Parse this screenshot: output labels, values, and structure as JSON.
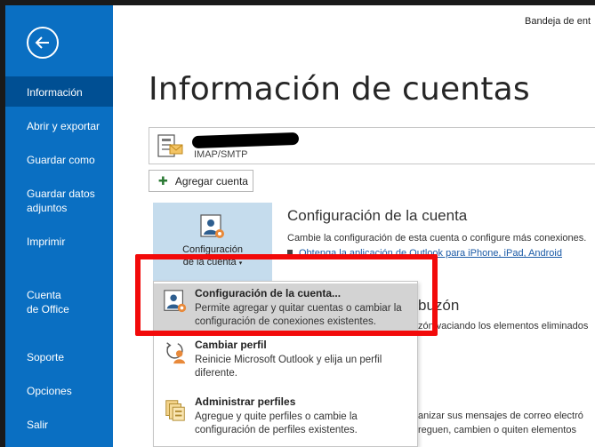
{
  "window": {
    "title_partial": "Bandeja de ent"
  },
  "sidebar": {
    "items": [
      {
        "label": "Información",
        "active": true
      },
      {
        "label": "Abrir y exportar"
      },
      {
        "label": "Guardar como"
      },
      {
        "label": "Guardar datos adjuntos"
      },
      {
        "label": "Imprimir"
      },
      {
        "label": "Cuenta de Office"
      },
      {
        "label": "Soporte"
      },
      {
        "label": "Opciones"
      },
      {
        "label": "Salir"
      }
    ]
  },
  "main": {
    "page_title": "Información de cuentas",
    "account": {
      "type": "IMAP/SMTP"
    },
    "add_account_label": "Agregar cuenta",
    "config_tile": {
      "line1": "Configuración",
      "line2": "de la cuenta"
    },
    "account_settings": {
      "heading": "Configuración de la cuenta",
      "description": "Cambie la configuración de esta cuenta o configure más conexiones.",
      "link": "Obtenga la aplicación de Outlook para iPhone, iPad, Android"
    },
    "mailbox": {
      "heading_partial": "buzón",
      "description_partial": "zón vaciando los elementos eliminados"
    },
    "cleanup": {
      "line1_partial": "anizar sus mensajes de correo electró",
      "line2_partial": "reguen, cambien o quiten elementos"
    }
  },
  "menu": {
    "items": [
      {
        "title": "Configuración de la cuenta...",
        "description": "Permite agregar y quitar cuentas o cambiar la configuración de conexiones existentes.",
        "icon": "account-settings-icon",
        "selected": true
      },
      {
        "title": "Cambiar perfil",
        "description": "Reinicie Microsoft Outlook y elija un perfil diferente.",
        "icon": "change-profile-icon"
      },
      {
        "title": "Administrar perfiles",
        "description": "Agregue y quite perfiles o cambie la configuración de perfiles existentes.",
        "icon": "manage-profiles-icon"
      }
    ]
  },
  "colors": {
    "sidebar": "#0a6fc2",
    "sidebar_active": "#004f93",
    "tile": "#c5dced",
    "highlight": "#f20a0a"
  }
}
